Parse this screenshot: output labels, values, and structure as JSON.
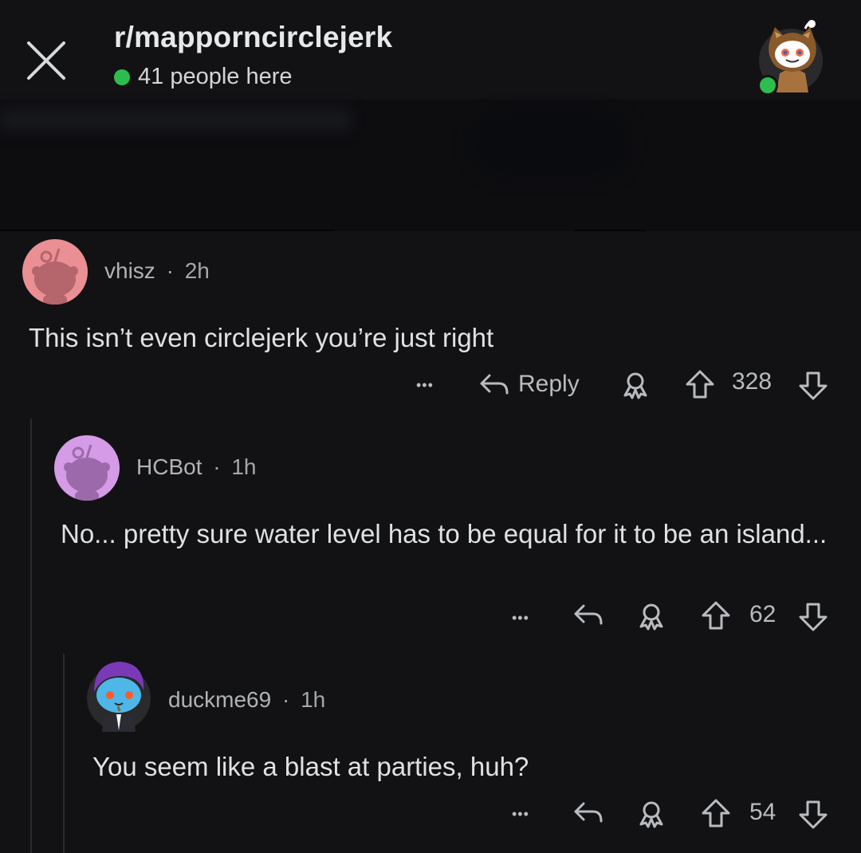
{
  "header": {
    "subreddit": "r/mapporncirclejerk",
    "online_count": "41 people here",
    "close_icon": "close-icon",
    "avatar_icon": "snoo-owl-avatar"
  },
  "colors": {
    "background": "#121214",
    "online_green": "#2dbd4e",
    "avatar_pink": "#ea8f93",
    "avatar_lilac": "#d59be6"
  },
  "comments": [
    {
      "username": "vhisz",
      "sep": "·",
      "age": "2h",
      "text": "This isn’t even circlejerk you’re just right",
      "reply_label": "Reply",
      "more_label": "•••",
      "score": "328"
    },
    {
      "username": "HCBot",
      "sep": "·",
      "age": "1h",
      "text": "No... pretty sure water level has to be equal for it to be an island...",
      "more_label": "•••",
      "score": "62"
    },
    {
      "username": "duckme69",
      "sep": "·",
      "age": "1h",
      "text": "You seem like a blast at parties, huh?",
      "more_label": "•••",
      "score": "54"
    }
  ]
}
